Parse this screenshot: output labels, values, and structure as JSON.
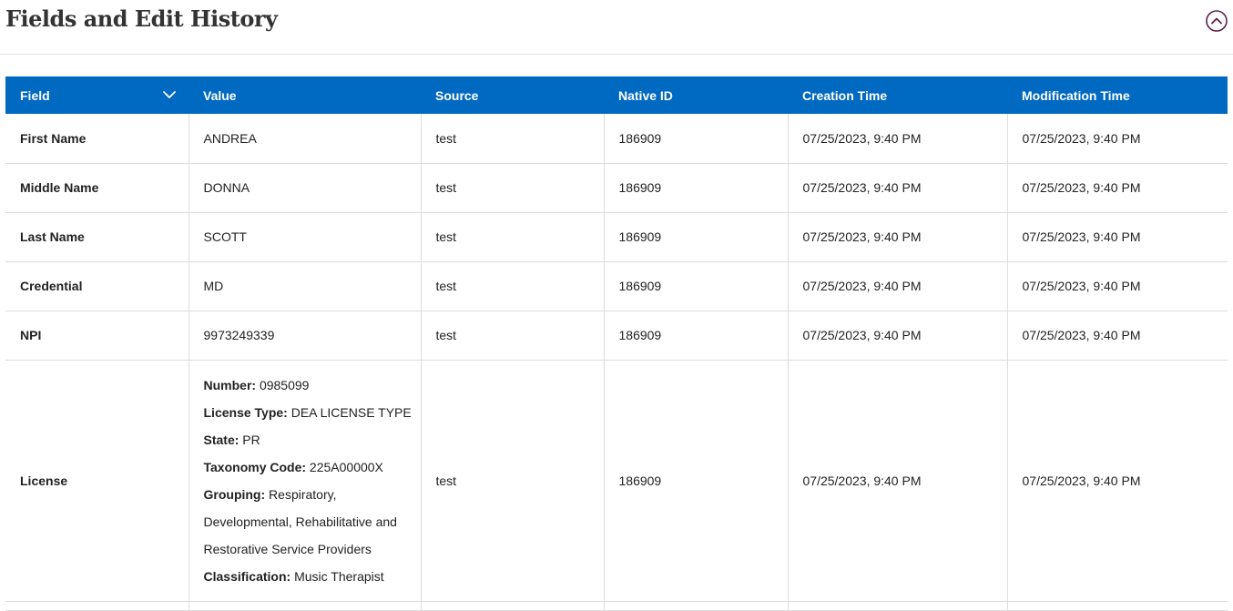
{
  "header": {
    "title": "Fields and Edit History"
  },
  "table": {
    "columns": [
      "Field",
      "Value",
      "Source",
      "Native ID",
      "Creation Time",
      "Modification Time"
    ],
    "rows": [
      {
        "field": "First Name",
        "value": "ANDREA",
        "source": "test",
        "native_id": "186909",
        "created": "07/25/2023, 9:40 PM",
        "modified": "07/25/2023, 9:40 PM"
      },
      {
        "field": "Middle Name",
        "value": "DONNA",
        "source": "test",
        "native_id": "186909",
        "created": "07/25/2023, 9:40 PM",
        "modified": "07/25/2023, 9:40 PM"
      },
      {
        "field": "Last Name",
        "value": "SCOTT",
        "source": "test",
        "native_id": "186909",
        "created": "07/25/2023, 9:40 PM",
        "modified": "07/25/2023, 9:40 PM"
      },
      {
        "field": "Credential",
        "value": "MD",
        "source": "test",
        "native_id": "186909",
        "created": "07/25/2023, 9:40 PM",
        "modified": "07/25/2023, 9:40 PM"
      },
      {
        "field": "NPI",
        "value": "9973249339",
        "source": "test",
        "native_id": "186909",
        "created": "07/25/2023, 9:40 PM",
        "modified": "07/25/2023, 9:40 PM"
      }
    ],
    "license_row": {
      "field": "License",
      "value": [
        {
          "key": "Number:",
          "val": "0985099"
        },
        {
          "key": "License Type:",
          "val": "DEA LICENSE TYPE"
        },
        {
          "key": "State:",
          "val": "PR"
        },
        {
          "key": "Taxonomy Code:",
          "val": "225A00000X"
        },
        {
          "key": "Grouping:",
          "val": "Respiratory, Developmental, Rehabilitative and Restorative Service Providers"
        },
        {
          "key": "Classification:",
          "val": "Music Therapist"
        }
      ],
      "source": "test",
      "native_id": "186909",
      "created": "07/25/2023, 9:40 PM",
      "modified": "07/25/2023, 9:40 PM"
    }
  },
  "icons": {
    "collapse": "chevron-up-circle-icon",
    "sort": "chevron-down-icon"
  },
  "colors": {
    "header_bg": "#0069c2",
    "accent": "#5b1f4e"
  }
}
